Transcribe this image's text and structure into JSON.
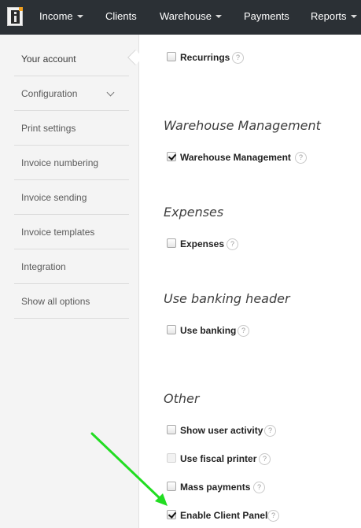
{
  "navbar": {
    "logo_icon": "invoice-app-logo-icon",
    "items": [
      {
        "label": "Income",
        "has_caret": true
      },
      {
        "label": "Clients",
        "has_caret": false
      },
      {
        "label": "Warehouse",
        "has_caret": true
      },
      {
        "label": "Payments",
        "has_caret": false
      },
      {
        "label": "Reports",
        "has_caret": true
      }
    ]
  },
  "sidebar": {
    "items": [
      {
        "label": "Your account",
        "active": true
      },
      {
        "label": "Configuration",
        "expandable": true
      },
      {
        "label": "Print settings"
      },
      {
        "label": "Invoice numbering"
      },
      {
        "label": "Invoice sending"
      },
      {
        "label": "Invoice templates"
      },
      {
        "label": "Integration"
      },
      {
        "label": "Show all options"
      }
    ]
  },
  "main": {
    "recurrings": {
      "label": "Recurrings",
      "checked": false,
      "help": "?"
    },
    "warehouse": {
      "title": "Warehouse Management",
      "option": {
        "label": "Warehouse Management",
        "checked": true,
        "help": "?"
      }
    },
    "expenses": {
      "title": "Expenses",
      "option": {
        "label": "Expenses",
        "checked": false,
        "help": "?"
      }
    },
    "banking": {
      "title": "Use banking header",
      "option": {
        "label": "Use banking",
        "checked": false,
        "help": "?"
      }
    },
    "other": {
      "title": "Other",
      "options": [
        {
          "label": "Show user activity",
          "checked": false,
          "disabled": false,
          "help": "?"
        },
        {
          "label": "Use fiscal printer",
          "checked": false,
          "disabled": true,
          "help": "?"
        },
        {
          "label": "Mass payments",
          "checked": false,
          "disabled": false,
          "help": "?"
        },
        {
          "label": "Enable Client Panel",
          "checked": true,
          "disabled": false,
          "help": "?"
        }
      ]
    }
  },
  "annotation": {
    "arrow_color": "#22dd22",
    "points_to": "Enable Client Panel"
  },
  "colors": {
    "navbar": "#2b3035",
    "sidebar": "#f4f4f4"
  }
}
